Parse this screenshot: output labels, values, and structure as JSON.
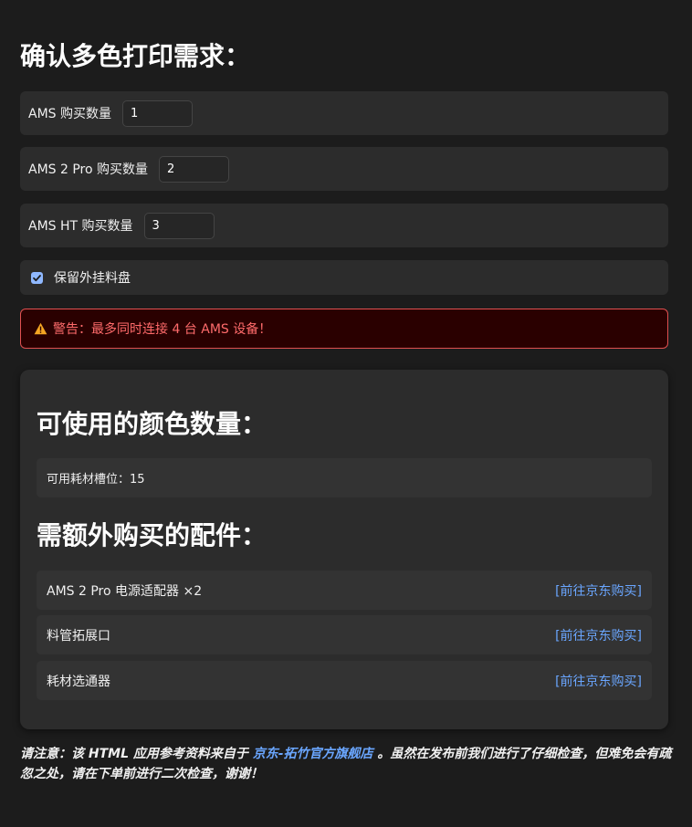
{
  "header": {
    "title": "确认多色打印需求："
  },
  "inputs": [
    {
      "label": "AMS 购买数量",
      "value": "1"
    },
    {
      "label": "AMS 2 Pro 购买数量",
      "value": "2"
    },
    {
      "label": "AMS HT 购买数量",
      "value": "3"
    }
  ],
  "keep_spool": {
    "label": "保留外挂料盘",
    "checked": true
  },
  "warning": {
    "icon": "warning-icon",
    "text": "警告：最多同时连接 4 台 AMS 设备！",
    "color": "#ff6b6b"
  },
  "result": {
    "colors_title": "可使用的颜色数量：",
    "slots_text": "可用耗材槽位：15",
    "accessories_title": "需额外购买的配件：",
    "accessories": [
      {
        "name": "AMS 2 Pro 电源适配器 ×2",
        "link": "[前往京东购买]"
      },
      {
        "name": "料管拓展口",
        "link": "[前往京东购买]"
      },
      {
        "name": "耗材选通器",
        "link": "[前往京东购买]"
      }
    ]
  },
  "footer": {
    "prefix": "请注意：该 HTML 应用参考资料来自于 ",
    "link_text": "京东-拓竹官方旗舰店",
    "suffix": " 。虽然在发布前我们进行了仔细检查，但难免会有疏忽之处，请在下单前进行二次检查，谢谢！"
  },
  "colors": {
    "background": "#1c1c1c",
    "card": "#2c2c2c",
    "link": "#6aa6ff",
    "warning_border": "#e05050",
    "warning_bg": "#2a0000"
  }
}
